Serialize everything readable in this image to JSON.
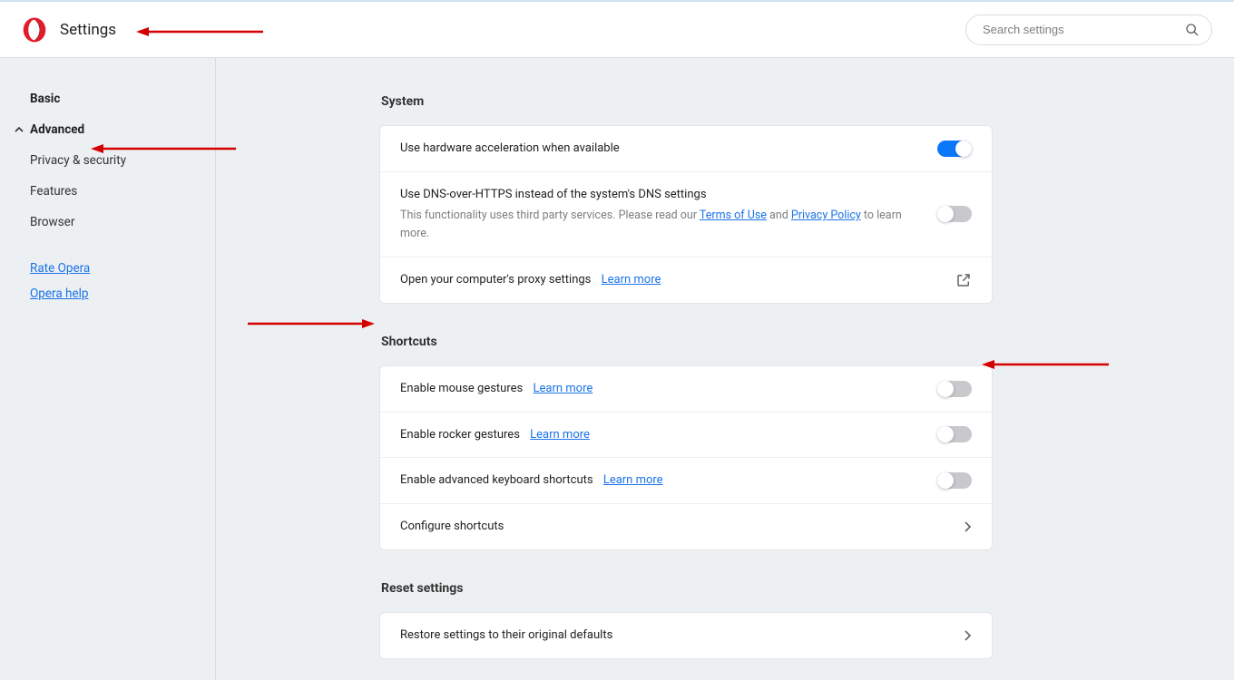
{
  "header": {
    "title": "Settings",
    "search_placeholder": "Search settings"
  },
  "sidebar": {
    "basic": "Basic",
    "advanced": "Advanced",
    "privacy": "Privacy & security",
    "features": "Features",
    "browser": "Browser",
    "rate": "Rate Opera",
    "help": "Opera help"
  },
  "sections": {
    "system": {
      "title": "System",
      "hw_accel": "Use hardware acceleration when available",
      "dns_title": "Use DNS-over-HTTPS instead of the system's DNS settings",
      "dns_sub_pre": "This functionality uses third party services. Please read our ",
      "dns_tos": "Terms of Use",
      "dns_and": " and ",
      "dns_pp": "Privacy Policy",
      "dns_post": " to learn more.",
      "proxy": "Open your computer's proxy settings",
      "proxy_learn": "Learn more"
    },
    "shortcuts": {
      "title": "Shortcuts",
      "mouse": "Enable mouse gestures",
      "rocker": "Enable rocker gestures",
      "keyboard": "Enable advanced keyboard shortcuts",
      "learn": "Learn more",
      "configure": "Configure shortcuts"
    },
    "reset": {
      "title": "Reset settings",
      "restore": "Restore settings to their original defaults"
    }
  },
  "toggles": {
    "hw_accel": true,
    "dns": false,
    "mouse": false,
    "rocker": false,
    "keyboard": false
  }
}
